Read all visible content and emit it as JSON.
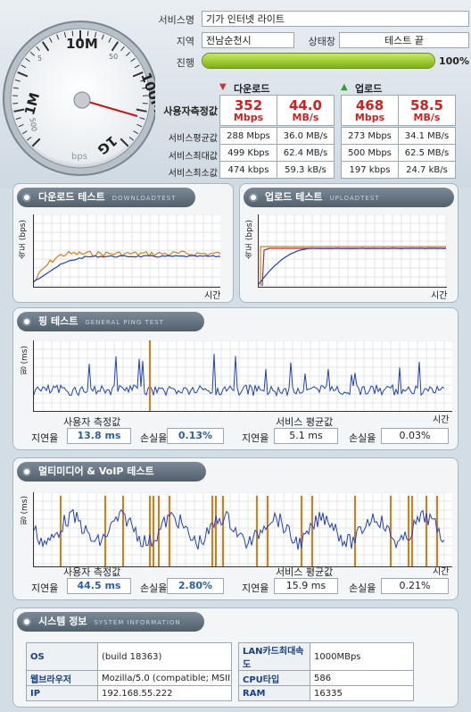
{
  "header": {
    "service_name_label": "서비스명",
    "service_name": "기가 인터넷 라이트",
    "region_label": "지역",
    "region": "전남순천시",
    "status_label": "상태창",
    "status": "테스트 끝",
    "progress_label": "진행",
    "progress_percent": 100,
    "progress_text": "100%"
  },
  "gauge": {
    "ticks": [
      "1M",
      "10M",
      "100M",
      "1G",
      "5",
      "50",
      "500"
    ],
    "unit": "bps",
    "needle_value": "352 Mbps"
  },
  "stats": {
    "download_label": "다운로드",
    "upload_label": "업로드",
    "measured_label": "사용자측정값",
    "rows": [
      {
        "label": "서비스평균값",
        "values": [
          "288 Mbps",
          "36.0 MB/s",
          "273 Mbps",
          "34.1 MB/s"
        ]
      },
      {
        "label": "서비스최대값",
        "values": [
          "499 Kbps",
          "62.4 MB/s",
          "500 Mbps",
          "62.5 MB/s"
        ]
      },
      {
        "label": "서비스최소값",
        "values": [
          "474 kbps",
          "59.3 kB/s",
          "197 kbps",
          "24.7 kB/s"
        ]
      }
    ],
    "measured": [
      {
        "value": "352",
        "unit": "Mbps"
      },
      {
        "value": "44.0",
        "unit": "MB/s"
      },
      {
        "value": "468",
        "unit": "Mbps"
      },
      {
        "value": "58.5",
        "unit": "MB/s"
      }
    ]
  },
  "download_test": {
    "title": "다운로드 테스트",
    "subtitle": "DOWNLOADTEST",
    "ylabel": "속도 (bps)",
    "xlabel": "시간"
  },
  "upload_test": {
    "title": "업로드 테스트",
    "subtitle": "UPLOADTEST",
    "ylabel": "속도 (bps)",
    "xlabel": "시간"
  },
  "ping_test": {
    "title": "핑 테스트",
    "subtitle": "GENERAL PING TEST",
    "ylabel": "핑 (ms)",
    "xlabel": "시간",
    "user_label": "사용자 측정값",
    "avg_label": "서비스 평균값",
    "latency_label": "지연율",
    "loss_label": "손실율",
    "user_latency": "13.8 ms",
    "user_loss": "0.13%",
    "avg_latency": "5.1 ms",
    "avg_loss": "0.03%"
  },
  "voip_test": {
    "title": "멀티미디어 & VoIP 테스트",
    "ylabel": "핑 (ms)",
    "xlabel": "시간",
    "user_label": "사용자 측정값",
    "avg_label": "서비스 평균값",
    "latency_label": "지연율",
    "loss_label": "손실율",
    "user_latency": "44.5 ms",
    "user_loss": "2.80%",
    "avg_latency": "15.9 ms",
    "avg_loss": "0.21%"
  },
  "system_info": {
    "title": "시스템 정보",
    "subtitle": "SYSTEM INFORMATION",
    "rows": [
      {
        "l1": "OS",
        "v1": "(build 18363)",
        "l2": "LAN카드최대속도",
        "v2": "1000MBps"
      },
      {
        "l1": "웹브라우저",
        "v1": "Mozilla/5.0 (compatible; MSII",
        "l2": "CPU타입",
        "v2": "586"
      },
      {
        "l1": "IP",
        "v1": "192.168.55.222",
        "l2": "RAM",
        "v2": "16335"
      }
    ]
  },
  "colors": {
    "download_arrow": "#d03030",
    "upload_arrow": "#30a030",
    "series_orange": "#e07a10",
    "series_blue": "#2040c0"
  }
}
